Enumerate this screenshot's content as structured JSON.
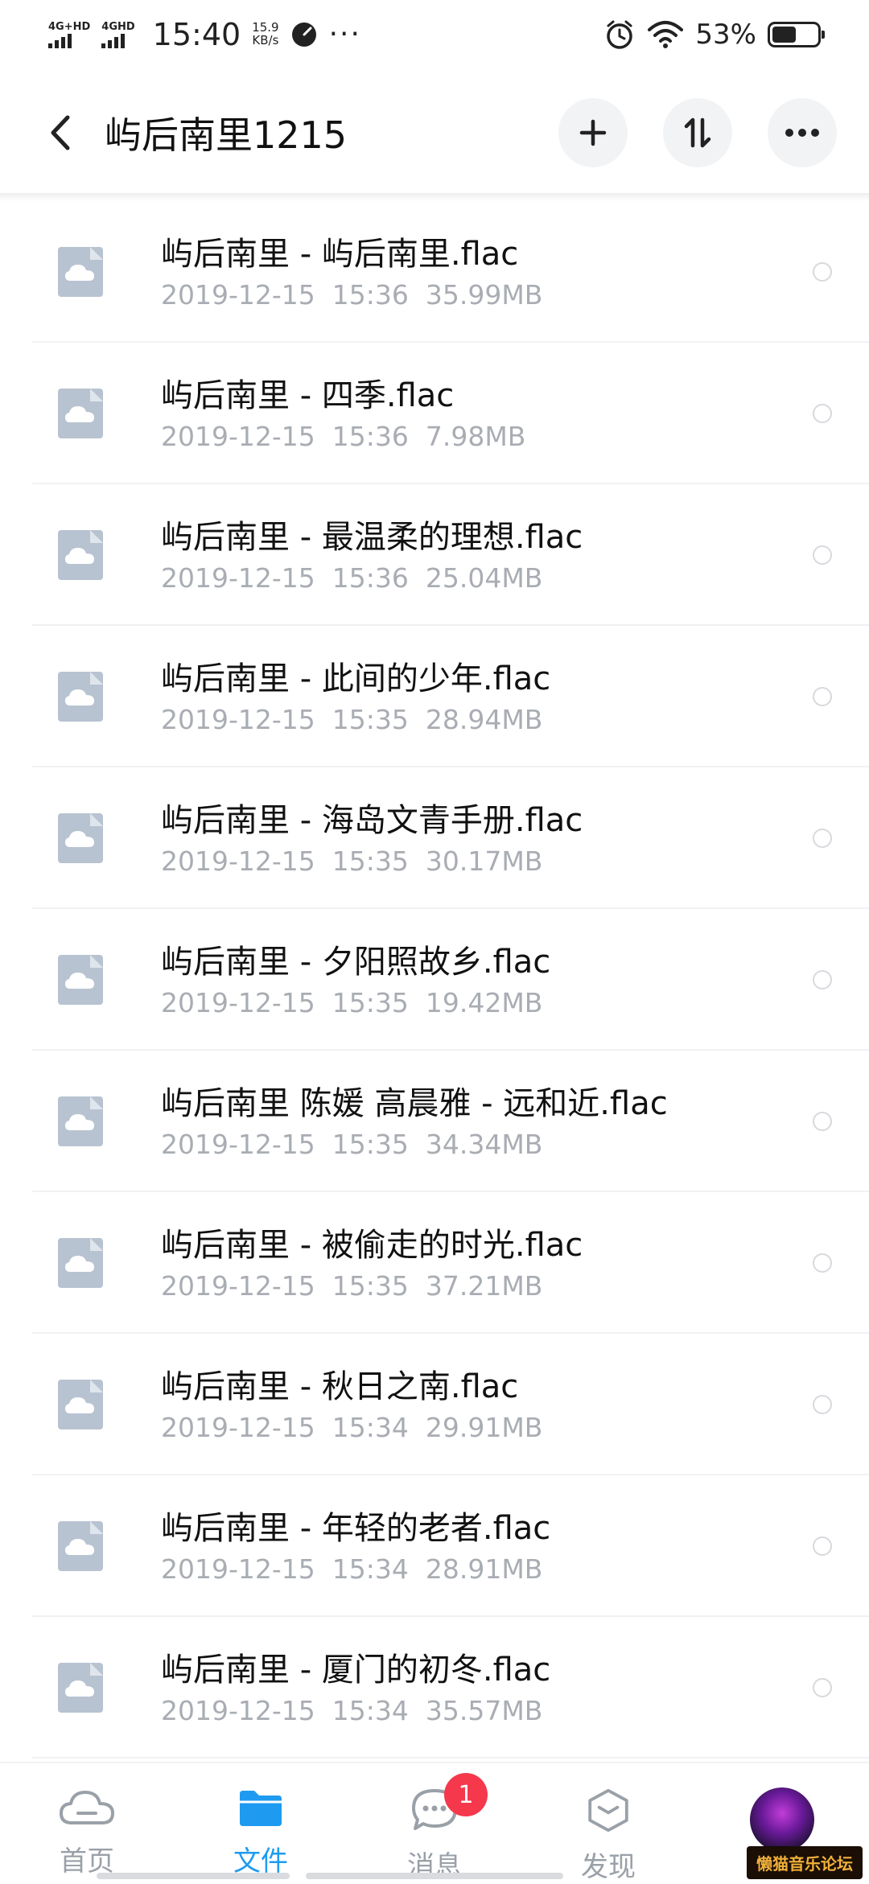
{
  "status_bar": {
    "net1": "4G+HD",
    "net2": "4GHD",
    "time": "15:40",
    "speed_value": "15.9",
    "speed_unit": "KB/s",
    "more": "···",
    "battery": "53%",
    "battery_level": 0.53
  },
  "header": {
    "title": "屿后南里1215"
  },
  "files": [
    {
      "name": "屿后南里 - 屿后南里.flac",
      "date": "2019-12-15",
      "time": "15:36",
      "size": "35.99MB"
    },
    {
      "name": "屿后南里 - 四季.flac",
      "date": "2019-12-15",
      "time": "15:36",
      "size": "7.98MB"
    },
    {
      "name": "屿后南里 - 最温柔的理想.flac",
      "date": "2019-12-15",
      "time": "15:36",
      "size": "25.04MB"
    },
    {
      "name": "屿后南里 - 此间的少年.flac",
      "date": "2019-12-15",
      "time": "15:35",
      "size": "28.94MB"
    },
    {
      "name": "屿后南里 - 海岛文青手册.flac",
      "date": "2019-12-15",
      "time": "15:35",
      "size": "30.17MB"
    },
    {
      "name": "屿后南里 - 夕阳照故乡.flac",
      "date": "2019-12-15",
      "time": "15:35",
      "size": "19.42MB"
    },
    {
      "name": "屿后南里 陈媛 高晨雅 - 远和近.flac",
      "date": "2019-12-15",
      "time": "15:35",
      "size": "34.34MB"
    },
    {
      "name": "屿后南里 - 被偷走的时光.flac",
      "date": "2019-12-15",
      "time": "15:35",
      "size": "37.21MB"
    },
    {
      "name": "屿后南里 - 秋日之南.flac",
      "date": "2019-12-15",
      "time": "15:34",
      "size": "29.91MB"
    },
    {
      "name": "屿后南里 - 年轻的老者.flac",
      "date": "2019-12-15",
      "time": "15:34",
      "size": "28.91MB"
    },
    {
      "name": "屿后南里 - 厦门的初冬.flac",
      "date": "2019-12-15",
      "time": "15:34",
      "size": "35.57MB"
    }
  ],
  "nav": {
    "home": "首页",
    "files": "文件",
    "messages": "消息",
    "discover": "发现",
    "messages_badge": "1"
  },
  "watermark": "懒猫音乐论坛",
  "colors": {
    "accent": "#1e9bf0",
    "icon_gray": "#b8c3d1",
    "badge_red": "#f5384c",
    "meta_gray": "#a9adb3"
  }
}
